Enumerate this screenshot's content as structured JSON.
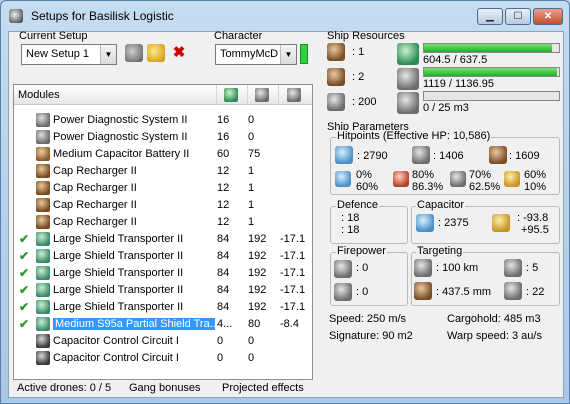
{
  "window": {
    "title": "Setups for Basilisk Logistic"
  },
  "current_setup": {
    "label": "Current Setup",
    "value": "New Setup 1"
  },
  "character": {
    "label": "Character",
    "value": "TommyMcD"
  },
  "modules": {
    "header": "Modules",
    "rows": [
      {
        "checked": false,
        "icon": "ship-icon",
        "name": "Power Diagnostic System II",
        "c1": "16",
        "c2": "0",
        "c3": ""
      },
      {
        "checked": false,
        "icon": "ship-icon",
        "name": "Power Diagnostic System II",
        "c1": "16",
        "c2": "0",
        "c3": ""
      },
      {
        "checked": false,
        "icon": "battery-icon",
        "name": "Medium Capacitor Battery II",
        "c1": "60",
        "c2": "75",
        "c3": ""
      },
      {
        "checked": false,
        "icon": "recharger-icon",
        "name": "Cap Recharger II",
        "c1": "12",
        "c2": "1",
        "c3": ""
      },
      {
        "checked": false,
        "icon": "recharger-icon",
        "name": "Cap Recharger II",
        "c1": "12",
        "c2": "1",
        "c3": ""
      },
      {
        "checked": false,
        "icon": "recharger-icon",
        "name": "Cap Recharger II",
        "c1": "12",
        "c2": "1",
        "c3": ""
      },
      {
        "checked": false,
        "icon": "recharger-icon",
        "name": "Cap Recharger II",
        "c1": "12",
        "c2": "1",
        "c3": ""
      },
      {
        "checked": true,
        "icon": "shield-transporter-icon",
        "name": "Large Shield Transporter II",
        "c1": "84",
        "c2": "192",
        "c3": "-17.1"
      },
      {
        "checked": true,
        "icon": "shield-transporter-icon",
        "name": "Large Shield Transporter II",
        "c1": "84",
        "c2": "192",
        "c3": "-17.1"
      },
      {
        "checked": true,
        "icon": "shield-transporter-icon",
        "name": "Large Shield Transporter II",
        "c1": "84",
        "c2": "192",
        "c3": "-17.1"
      },
      {
        "checked": true,
        "icon": "shield-transporter-icon",
        "name": "Large Shield Transporter II",
        "c1": "84",
        "c2": "192",
        "c3": "-17.1"
      },
      {
        "checked": true,
        "icon": "shield-transporter-icon",
        "name": "Large Shield Transporter II",
        "c1": "84",
        "c2": "192",
        "c3": "-17.1"
      },
      {
        "checked": true,
        "icon": "shield-transporter-icon",
        "name": "Medium S95a Partial Shield Tra...",
        "c1": "4...",
        "c2": "80",
        "c3": "-8.4",
        "selected": true
      },
      {
        "checked": false,
        "icon": "circuit-icon",
        "name": "Capacitor Control Circuit I",
        "c1": "0",
        "c2": "0",
        "c3": ""
      },
      {
        "checked": false,
        "icon": "circuit-icon",
        "name": "Capacitor Control Circuit I",
        "c1": "0",
        "c2": "0",
        "c3": ""
      }
    ]
  },
  "bottom": {
    "drones": "Active drones: 0 / 5",
    "gang": "Gang bonuses",
    "projected": "Projected effects"
  },
  "resources": {
    "label": "Ship Resources",
    "hi_slots": ": 1",
    "med_slots": ": 2",
    "drone_bay": ": 200",
    "cpu": {
      "text": "604.5 / 637.5",
      "fraction": 0.948
    },
    "powergrid": {
      "text": "1119 / 1136.95",
      "fraction": 0.984
    },
    "cargo": {
      "text": "0 / 25 m3",
      "fraction": 0.0
    }
  },
  "params": {
    "label": "Ship Parameters",
    "hitpoints_label": "Hitpoints (Effective HP: 10,586)",
    "shield_hp": ": 2790",
    "armor_hp": ": 1406",
    "structure_hp": ": 1609",
    "res_shield_top": "0%",
    "res_shield_bot": "60%",
    "res_armor_top": "80%",
    "res_armor_bot": "86.3%",
    "res_kin_top": "70%",
    "res_kin_bot": "62.5%",
    "res_exp_top": "60%",
    "res_exp_bot": "10%",
    "defence_label": "Defence",
    "defence_top": ": 18",
    "defence_bot": ": 18",
    "capacitor_label": "Capacitor",
    "capacitor_value": ": 2375",
    "cap_delta_top": ": -93.8",
    "cap_delta_bot": "+95.5",
    "firepower_label": "Firepower",
    "firepower_top": ": 0",
    "firepower_bot": ": 0",
    "targeting_label": "Targeting",
    "range": ": 100 km",
    "max_targets": ": 5",
    "scan_res": ": 437.5 mm",
    "sensor_strength": ": 22",
    "speed": "Speed: 250 m/s",
    "cargohold": "Cargohold: 485 m3",
    "signature": "Signature: 90 m2",
    "warp": "Warp speed: 3 au/s"
  }
}
